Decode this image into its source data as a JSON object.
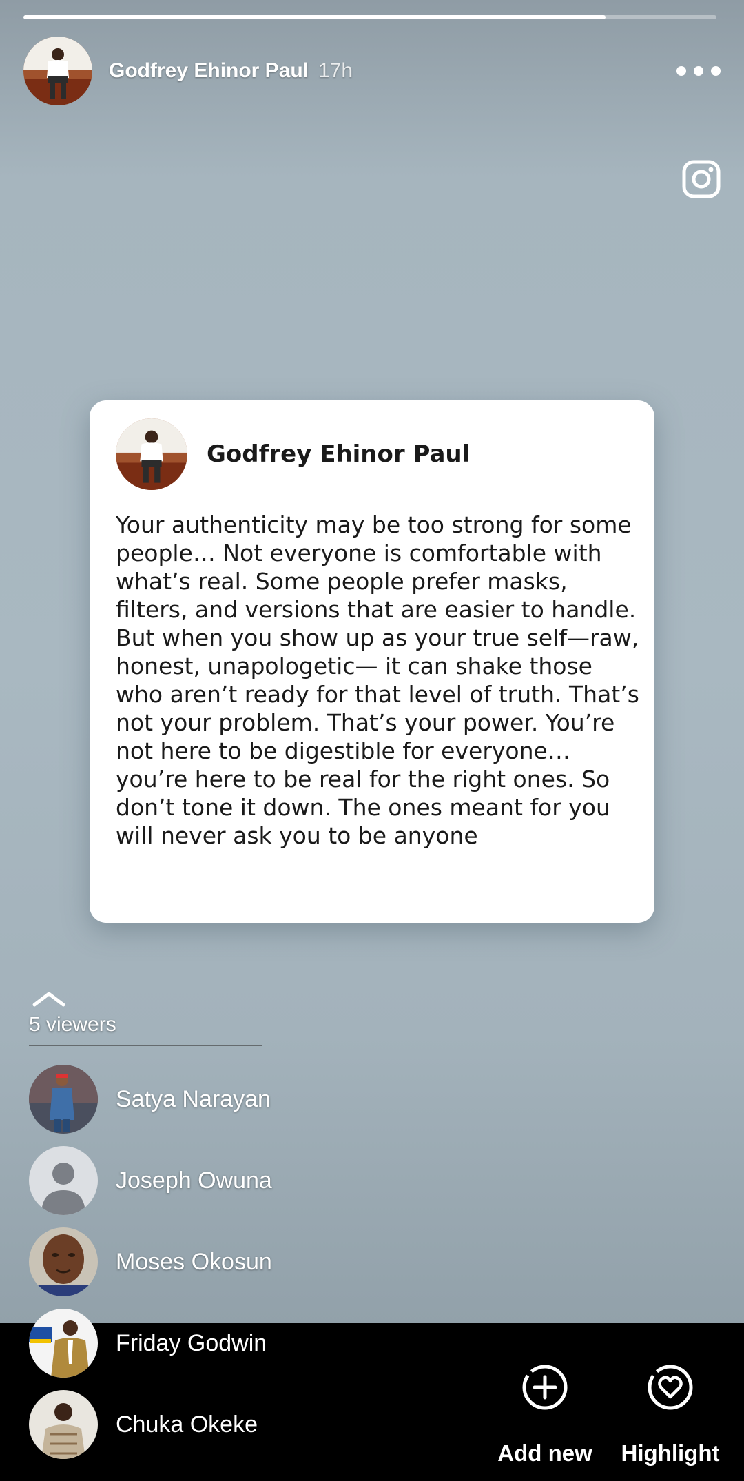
{
  "story": {
    "progress_fraction": 0.84,
    "author_name": "Godfrey Ehinor Paul",
    "time_ago": "17h",
    "more_icon": "more-horizontal-icon",
    "instagram_icon": "instagram-icon"
  },
  "post_card": {
    "author_name": "Godfrey Ehinor Paul",
    "text": "Your authenticity may be too strong for some people… Not everyone is comfortable with what’s real. Some people prefer masks, filters, and versions that are easier to handle. But when you show up as your true self—raw, honest, unapologetic— it can shake those who aren’t ready for that level of truth. That’s not your problem. That’s your power. You’re not here to be digestible for everyone… you’re here to be real for the right ones. So don’t tone it down. The ones meant for you will never ask you to be anyone"
  },
  "viewers": {
    "count_label": "5 viewers",
    "list": [
      {
        "name": "Satya Narayan"
      },
      {
        "name": "Joseph Owuna"
      },
      {
        "name": "Moses Okosun"
      },
      {
        "name": "Friday Godwin"
      },
      {
        "name": "Chuka Okeke"
      }
    ]
  },
  "actions": {
    "add_new_label": "Add new",
    "highlight_label": "Highlight"
  },
  "colors": {
    "background": "#a9b8c1",
    "bottom_bar": "#000000",
    "card": "#ffffff"
  }
}
